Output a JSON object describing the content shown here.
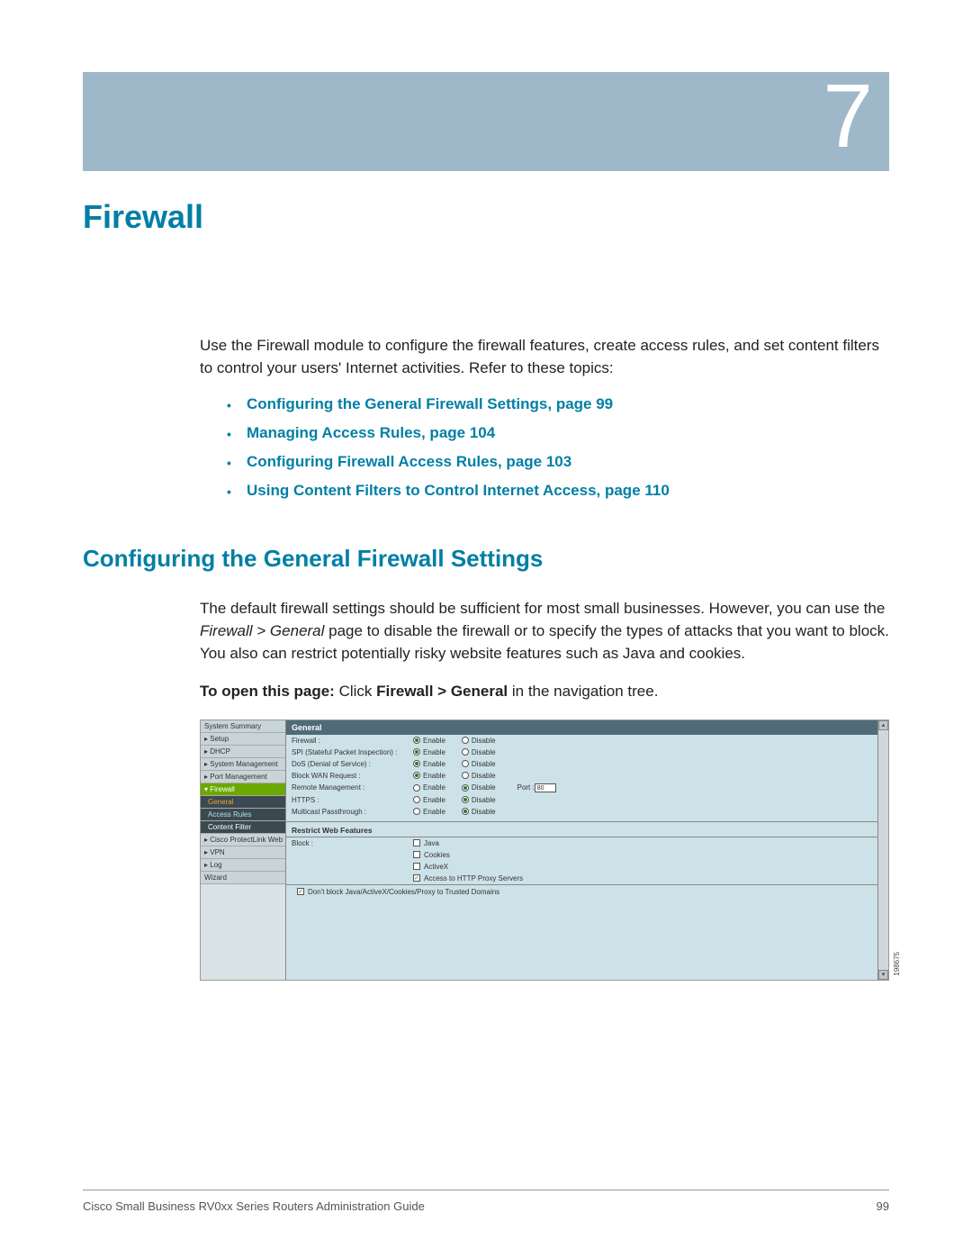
{
  "chapter": {
    "number": "7",
    "title": "Firewall"
  },
  "intro": "Use the Firewall module to configure the firewall features, create access rules, and set content filters to control your users' Internet activities. Refer to these topics:",
  "toc": [
    "Configuring the General Firewall Settings, page 99",
    "Managing Access Rules, page 104",
    "Configuring Firewall Access Rules, page 103",
    "Using Content Filters to Control Internet Access, page 110"
  ],
  "section": {
    "title": "Configuring the General Firewall Settings",
    "para1_a": "The default firewall settings should be sufficient for most small businesses. However, you can use the ",
    "para1_nav": "Firewall > General",
    "para1_b": " page to disable the firewall or to specify the types of attacks that you want to block. You also can restrict potentially risky website features such as Java and cookies.",
    "open_label": "To open this page: ",
    "open_a": "Click ",
    "open_nav": "Firewall > General",
    "open_b": " in the navigation tree."
  },
  "ss": {
    "nav": [
      "System Summary",
      "▸ Setup",
      "▸ DHCP",
      "▸ System Management",
      "▸ Port Management"
    ],
    "nav_active": "▾ Firewall",
    "nav_sub": [
      "General",
      "Access Rules",
      "Content Filter"
    ],
    "nav2": [
      "▸ Cisco ProtectLink Web",
      "▸ VPN",
      "▸ Log",
      "   Wizard"
    ],
    "header": "General",
    "rows": [
      {
        "label": "Firewall :",
        "enable": true
      },
      {
        "label": "SPI (Stateful Packet Inspection) :",
        "enable": true
      },
      {
        "label": "DoS (Denial of Service) :",
        "enable": true
      },
      {
        "label": "Block WAN Request :",
        "enable": true
      },
      {
        "label": "Remote Management :",
        "enable": false,
        "port": "80"
      },
      {
        "label": "HTTPS :",
        "enable": false
      },
      {
        "label": "Multicast Passthrough :",
        "enable": false
      }
    ],
    "opt_enable": "Enable",
    "opt_disable": "Disable",
    "port_label": "Port :",
    "section2": "Restrict Web Features",
    "block_label": "Block :",
    "blocks": [
      {
        "label": "Java",
        "checked": false
      },
      {
        "label": "Cookies",
        "checked": false
      },
      {
        "label": "ActiveX",
        "checked": false
      },
      {
        "label": "Access to HTTP Proxy Servers",
        "checked": true
      }
    ],
    "trusted": "Don't block Java/ActiveX/Cookies/Proxy to Trusted Domains",
    "imgnum": "198675"
  },
  "footer": {
    "title": "Cisco Small Business RV0xx Series Routers Administration Guide",
    "page": "99"
  }
}
